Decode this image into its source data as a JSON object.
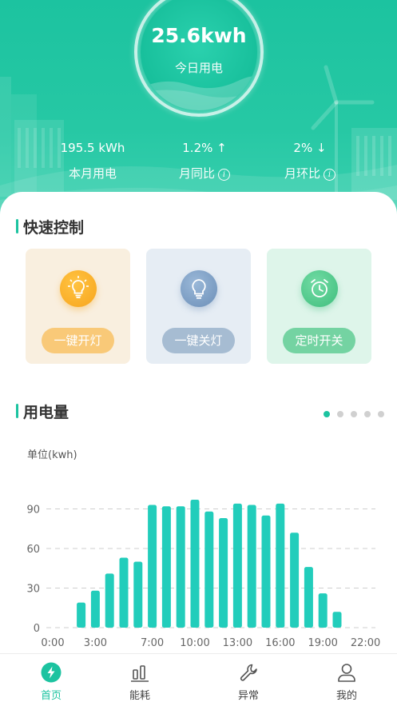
{
  "header": {
    "today_value": "25.6kwh",
    "today_label": "今日用电",
    "stats": [
      {
        "value": "195.5 kWh",
        "label": "本月用电",
        "info": false
      },
      {
        "value": "1.2% ↑",
        "label": "月同比",
        "info": true
      },
      {
        "value": "2% ↓",
        "label": "月环比",
        "info": true
      }
    ],
    "info_glyph": "i"
  },
  "quick_control": {
    "title": "快速控制",
    "cards": [
      {
        "icon": "bulb-on-icon",
        "label": "一键开灯"
      },
      {
        "icon": "bulb-off-icon",
        "label": "一键关灯"
      },
      {
        "icon": "alarm-clock-icon",
        "label": "定时开关"
      }
    ]
  },
  "usage": {
    "title": "用电量",
    "pager": {
      "count": 5,
      "active": 0
    }
  },
  "chart_data": {
    "type": "bar",
    "ylabel": "单位(kwh)",
    "ylim": [
      0,
      100
    ],
    "yticks": [
      0,
      30,
      60,
      90
    ],
    "xticks": [
      "0:00",
      "3:00",
      "7:00",
      "10:00",
      "13:00",
      "16:00",
      "19:00",
      "22:00"
    ],
    "xlim": [
      0,
      23
    ],
    "x": [
      2,
      3,
      4,
      5,
      6,
      7,
      8,
      9,
      10,
      11,
      12,
      13,
      14,
      15,
      16,
      17,
      18,
      19,
      20,
      21
    ],
    "values": [
      19,
      28,
      41,
      53,
      50,
      93,
      92,
      92,
      97,
      88,
      83,
      94,
      93,
      85,
      94,
      72,
      46,
      26,
      12,
      0
    ],
    "grid": "dashed horizontal",
    "color": "#22cdbb"
  },
  "nav": {
    "items": [
      {
        "icon": "bolt-icon",
        "label": "首页",
        "active": true
      },
      {
        "icon": "bar-chart-icon",
        "label": "能耗",
        "active": false
      },
      {
        "icon": "wrench-icon",
        "label": "异常",
        "active": false
      },
      {
        "icon": "user-icon",
        "label": "我的",
        "active": false
      }
    ]
  },
  "colors": {
    "brand": "#1cc3a0",
    "bar": "#22cdbb",
    "gauge_bg": "#17bf9b"
  }
}
